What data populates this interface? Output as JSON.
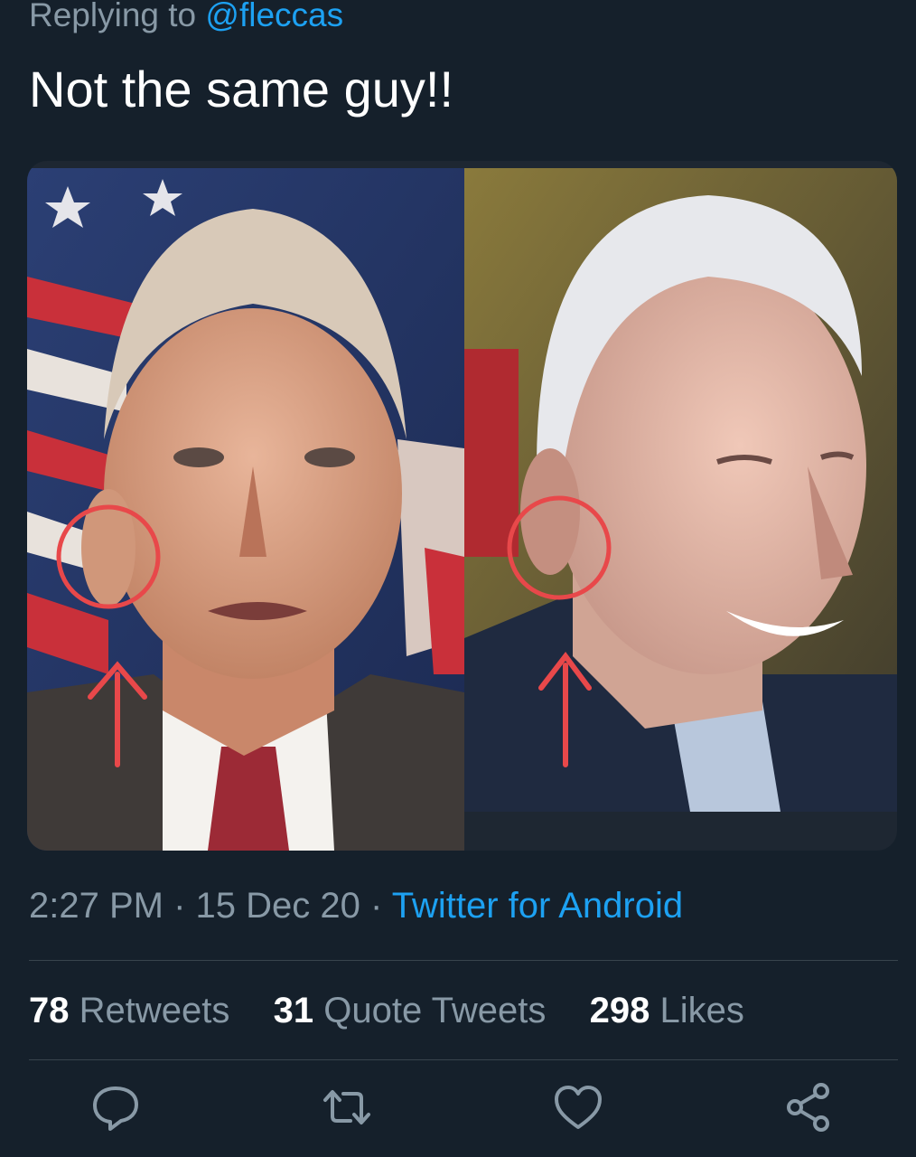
{
  "reply": {
    "prefix": "Replying to",
    "handle": "@fleccas"
  },
  "tweet": {
    "text": "Not the same guy!!"
  },
  "media": {
    "left_alt": "photo-of-man-circled-ear-left",
    "right_alt": "photo-of-man-circled-ear-right"
  },
  "meta": {
    "time": "2:27 PM",
    "separator": "·",
    "date": "15 Dec 20",
    "source": "Twitter for Android"
  },
  "stats": {
    "retweets_count": "78",
    "retweets_label": "Retweets",
    "quotes_count": "31",
    "quotes_label": "Quote Tweets",
    "likes_count": "298",
    "likes_label": "Likes"
  },
  "actions": {
    "icons": [
      "reply-icon",
      "retweet-icon",
      "like-icon",
      "share-icon"
    ]
  },
  "colors": {
    "background": "#15202b",
    "text": "#ffffff",
    "muted": "#8899a6",
    "accent": "#1da1f2",
    "divider": "#38444d",
    "annotation": "#e8484a"
  }
}
